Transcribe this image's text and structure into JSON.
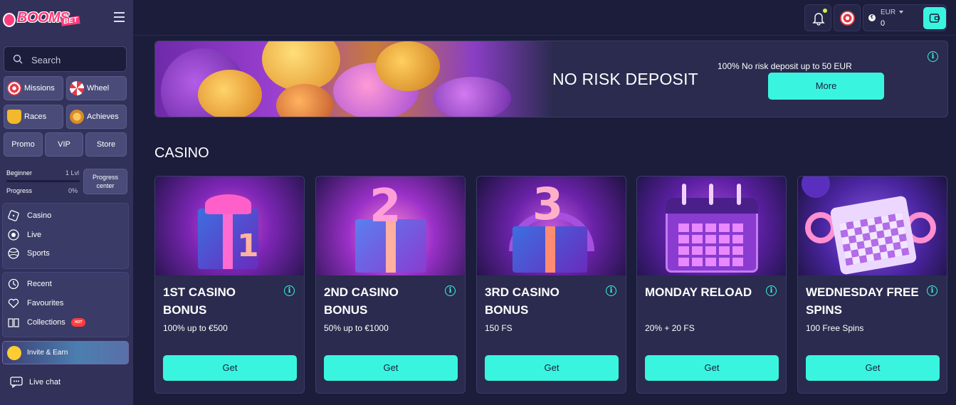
{
  "brand": {
    "logo_main": "BOOMS",
    "logo_sub": "BET"
  },
  "search": {
    "placeholder": "Search"
  },
  "quick_links": {
    "missions": "Missions",
    "wheel": "Wheel",
    "races": "Races",
    "achieves": "Achieves",
    "promo": "Promo",
    "vip": "VIP",
    "store": "Store"
  },
  "progress": {
    "level_label": "Beginner",
    "level_value": "1 Lvl",
    "progress_label": "Progress",
    "progress_value": "0%",
    "progress_fraction": 0,
    "center_line1": "Progress",
    "center_line2": "center"
  },
  "nav_main": [
    {
      "label": "Casino",
      "icon": "dice-icon"
    },
    {
      "label": "Live",
      "icon": "live-icon"
    },
    {
      "label": "Sports",
      "icon": "ball-icon"
    }
  ],
  "nav_personal": [
    {
      "label": "Recent",
      "icon": "history-icon"
    },
    {
      "label": "Favourites",
      "icon": "heart-icon"
    },
    {
      "label": "Collections",
      "icon": "book-icon",
      "badge": "HOT"
    }
  ],
  "invite": {
    "label": "Invite & Earn"
  },
  "livechat": {
    "label": "Live chat"
  },
  "wallet": {
    "currency": "EUR",
    "currency_symbol": "€",
    "amount": "0"
  },
  "banner": {
    "title": "NO RISK DEPOSIT",
    "subtitle": "100% No risk deposit up to 50 EUR",
    "button": "More",
    "info": "i"
  },
  "section": {
    "title": "CASINO"
  },
  "cards": [
    {
      "title": "1ST CASINO BONUS",
      "desc": "100% up to €500",
      "button": "Get",
      "image": "gift-1"
    },
    {
      "title": "2ND CASINO BONUS",
      "desc": "50% up to €1000",
      "button": "Get",
      "image": "gift-2"
    },
    {
      "title": "3RD CASINO BONUS",
      "desc": "150 FS",
      "button": "Get",
      "image": "gift-3"
    },
    {
      "title": "MONDAY RELOAD",
      "desc": "20% + 20 FS",
      "button": "Get",
      "image": "calendar"
    },
    {
      "title": "WEDNESDAY FREE SPINS",
      "desc": "100 Free Spins",
      "button": "Get",
      "image": "calendar-check"
    }
  ],
  "colors": {
    "accent": "#39f5e0",
    "brand": "#ff3c7d",
    "sidebar": "#31315a",
    "bg": "#1c1d3b",
    "card": "#2a2b4e",
    "hot": "#ff3c3c"
  }
}
